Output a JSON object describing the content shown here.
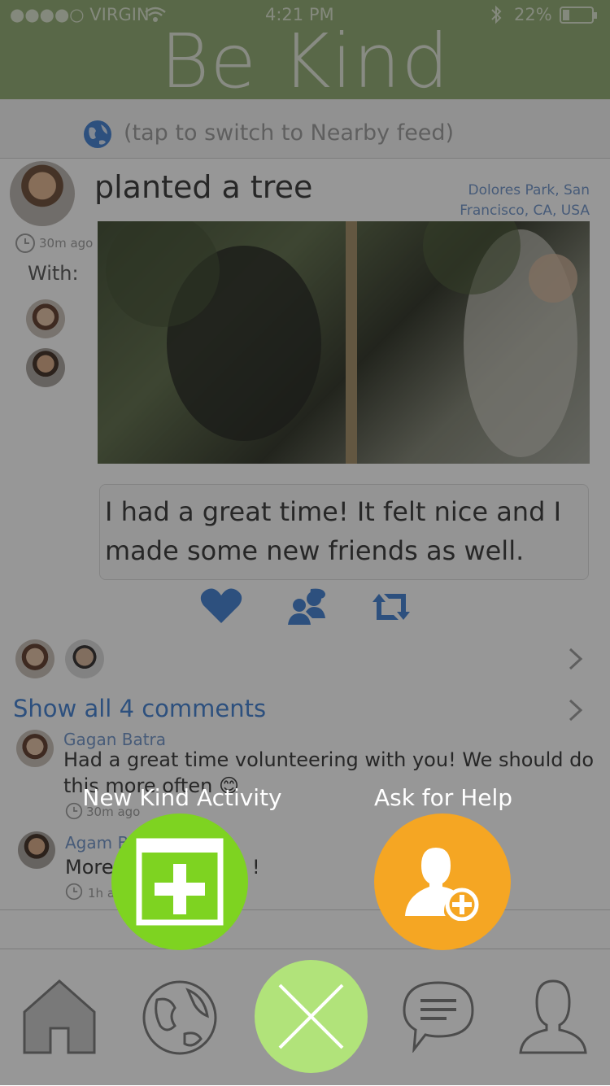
{
  "status_bar": {
    "carrier": "●●●●○ VIRGIN",
    "time": "4:21 PM",
    "battery": "22%"
  },
  "app": {
    "title": "Be Kind"
  },
  "feed": {
    "toggle_text": "(tap to switch to Nearby feed)"
  },
  "post": {
    "time": "30m ago",
    "with_label": "With:",
    "title": "planted a tree",
    "location_line1": "Dolores Park, San",
    "location_line2": "Francisco, CA, USA",
    "caption_line1": "I had a great time! It felt nice and I",
    "caption_line2": "made some new friends as well."
  },
  "comments": {
    "show_all": "Show all 4 comments",
    "items": [
      {
        "name": "Gagan Batra",
        "text_line1": "Had a great time volunteering with you! We should do",
        "text_line2": "this more often 😊",
        "time": "30m ago"
      },
      {
        "name": "Agam B",
        "text_line1": "More",
        "text_line2": "!",
        "time": "1h ago"
      }
    ]
  },
  "fab_menu": {
    "new_activity_label": "New Kind Activity",
    "ask_help_label": "Ask for Help"
  },
  "colors": {
    "header": "#8fa96f",
    "accent_blue": "#3f7fd2",
    "new_activity": "#7ed321",
    "ask_help": "#f5a623",
    "close": "#b1e37a"
  },
  "icons": [
    "wifi-icon",
    "bluetooth-icon",
    "battery-icon",
    "globe-icon",
    "clock-icon",
    "heart-icon",
    "people-icon",
    "repost-icon",
    "chevron-right-icon",
    "home-icon",
    "messages-icon",
    "profile-icon",
    "calendar-plus-icon",
    "user-plus-icon",
    "close-icon"
  ]
}
